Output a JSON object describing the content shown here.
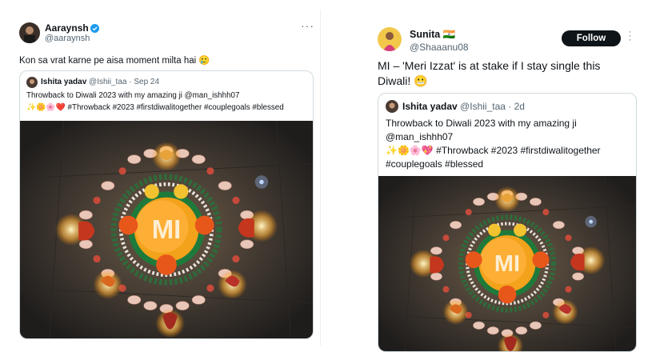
{
  "left_tweet": {
    "author_name": "Aaraynsh",
    "author_handle": "@aaraynsh",
    "text": "Kon sa vrat karne pe aisa moment milta hai 🥲",
    "more_icon": "more-horizontal-icon",
    "verified_icon": "verified-badge-icon",
    "quote": {
      "author_name": "Ishita yadav",
      "author_handle": "@Ishii_taa",
      "separator": "·",
      "date": "Sep 24",
      "line1": "Throwback to Diwali 2023 with my amazing ji @man_ishhh07",
      "line2": "✨🌼🌸❤️ #Throwback #2023 #firstdiwalitogether #couplegoals #blessed"
    }
  },
  "right_tweet": {
    "author_name": "Sunita 🇮🇳",
    "author_handle": "@Shaaanu08",
    "follow_label": "Follow",
    "more_icon": "more-vertical-icon",
    "text_line1": "MI – 'Meri Izzat' is at stake if I stay single this",
    "text_line2": "Diwali! 😬",
    "quote": {
      "author_name": "Ishita yadav",
      "author_handle": "@Ishii_taa",
      "separator": "·",
      "date": "2d",
      "line1": "Throwback to Diwali 2023 with my amazing ji",
      "line2": "@man_ishhh07",
      "line3": "✨🌼🌸💖 #Throwback #2023 #firstdiwalitogether",
      "line4": "#couplegoals #blessed"
    }
  },
  "image_text": "MI"
}
